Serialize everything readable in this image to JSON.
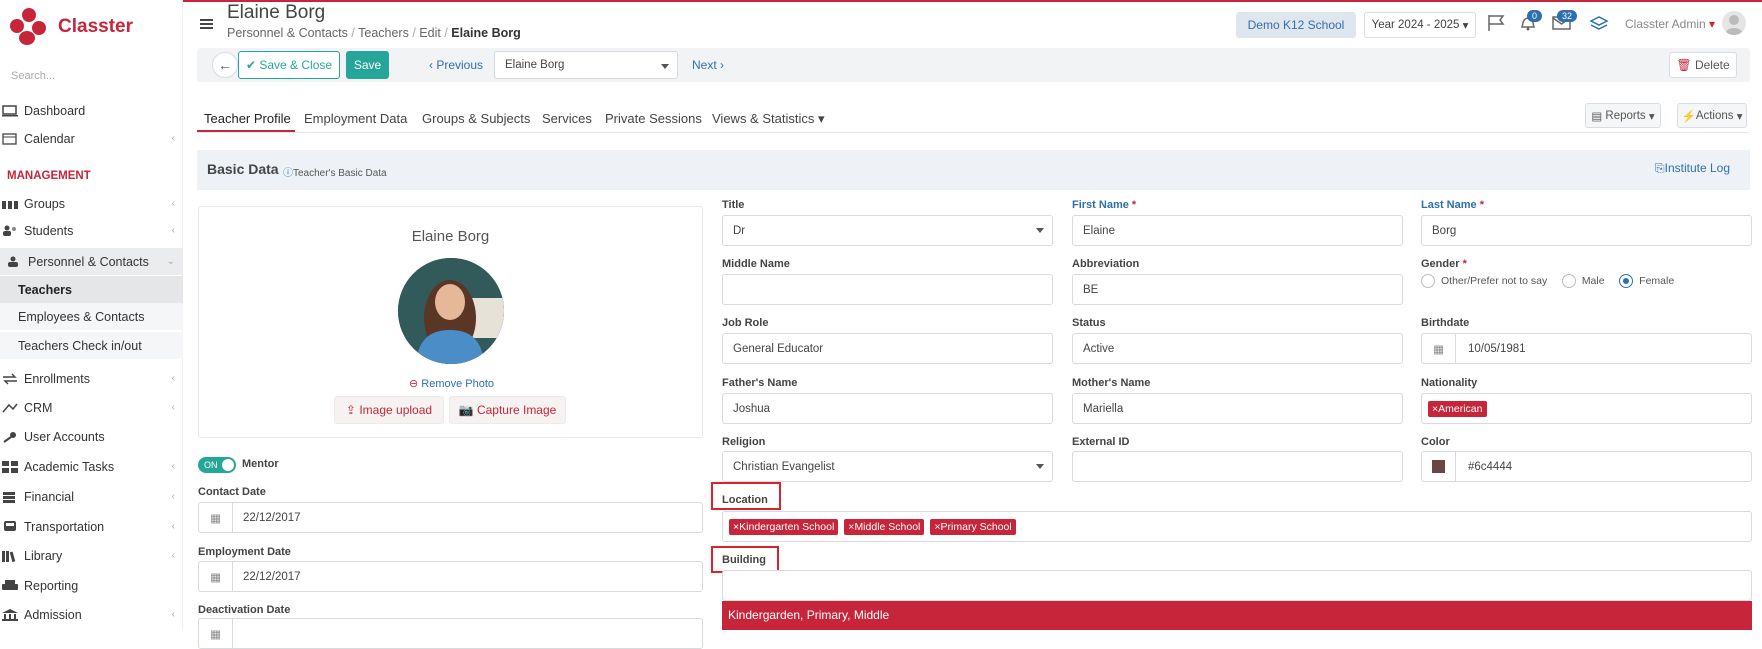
{
  "app": {
    "name": "Classter",
    "search_placeholder": "Search..."
  },
  "sidebar": {
    "section_label": "MANAGEMENT",
    "items": [
      {
        "label": "Dashboard",
        "icon": "monitor-icon"
      },
      {
        "label": "Calendar",
        "icon": "calendar-icon"
      },
      {
        "label": "Groups",
        "icon": "groups-icon"
      },
      {
        "label": "Students",
        "icon": "students-icon"
      },
      {
        "label": "Personnel & Contacts",
        "icon": "personnel-icon"
      },
      {
        "label": "Teachers",
        "icon": ""
      },
      {
        "label": "Employees & Contacts",
        "icon": ""
      },
      {
        "label": "Teachers Check in/out",
        "icon": ""
      },
      {
        "label": "Enrollments",
        "icon": "enrollments-icon"
      },
      {
        "label": "CRM",
        "icon": "crm-icon"
      },
      {
        "label": "User Accounts",
        "icon": "key-icon"
      },
      {
        "label": "Academic Tasks",
        "icon": "tasks-icon"
      },
      {
        "label": "Financial",
        "icon": "financial-icon"
      },
      {
        "label": "Transportation",
        "icon": "bus-icon"
      },
      {
        "label": "Library",
        "icon": "library-icon"
      },
      {
        "label": "Reporting",
        "icon": "printer-icon"
      },
      {
        "label": "Admission",
        "icon": "admission-icon"
      }
    ]
  },
  "header": {
    "title": "Elaine Borg",
    "breadcrumb": [
      "Personnel & Contacts",
      "Teachers",
      "Edit",
      "Elaine Borg"
    ],
    "school": "Demo K12 School",
    "year": "Year 2024 - 2025",
    "notifications_count": "0",
    "messages_count": "32",
    "user": "Classter Admin"
  },
  "toolbar": {
    "save_close": "Save & Close",
    "save": "Save",
    "previous": "Previous",
    "record": "Elaine Borg",
    "next": "Next",
    "delete": "Delete"
  },
  "tabs": [
    "Teacher Profile",
    "Employment Data",
    "Groups & Subjects",
    "Services",
    "Private Sessions",
    "Views & Statistics"
  ],
  "reports_label": "Reports",
  "actions_label": "Actions",
  "basic": {
    "title": "Basic Data",
    "subtitle": "Teacher's Basic Data",
    "institute_log": "Institute Log"
  },
  "profile": {
    "name": "Elaine Borg",
    "remove_photo": "Remove Photo",
    "image_upload": "Image upload",
    "capture_image": "Capture Image",
    "mentor_toggle": "ON",
    "mentor_label": "Mentor",
    "contact_date_label": "Contact Date",
    "contact_date": "22/12/2017",
    "employment_date_label": "Employment Date",
    "employment_date": "22/12/2017",
    "deactivation_date_label": "Deactivation Date"
  },
  "form": {
    "title_label": "Title",
    "title_value": "Dr",
    "first_name_label": "First Name",
    "first_name": "Elaine",
    "last_name_label": "Last Name",
    "last_name": "Borg",
    "middle_name_label": "Middle Name",
    "middle_name": "",
    "abbreviation_label": "Abbreviation",
    "abbreviation": "BE",
    "gender_label": "Gender",
    "gender_options": [
      "Other/Prefer not to say",
      "Male",
      "Female"
    ],
    "job_role_label": "Job Role",
    "job_role": "General Educator",
    "status_label": "Status",
    "status": "Active",
    "birthdate_label": "Birthdate",
    "birthdate": "10/05/1981",
    "fathers_name_label": "Father's Name",
    "fathers_name": "Joshua",
    "mothers_name_label": "Mother's Name",
    "mothers_name": "Mariella",
    "nationality_label": "Nationality",
    "nationality": "American",
    "religion_label": "Religion",
    "religion": "Christian Evangelist",
    "external_id_label": "External ID",
    "external_id": "",
    "color_label": "Color",
    "color": "#6c4444",
    "location_label": "Location",
    "locations": [
      "Kindergarten School",
      "Middle School",
      "Primary School"
    ],
    "building_label": "Building",
    "building_option": "Kindergarden, Primary, Middle"
  },
  "colors": {
    "brand": "#c7263a",
    "accent": "#2e6fb0",
    "save": "#26a69a",
    "swatch": "#6c4444"
  }
}
